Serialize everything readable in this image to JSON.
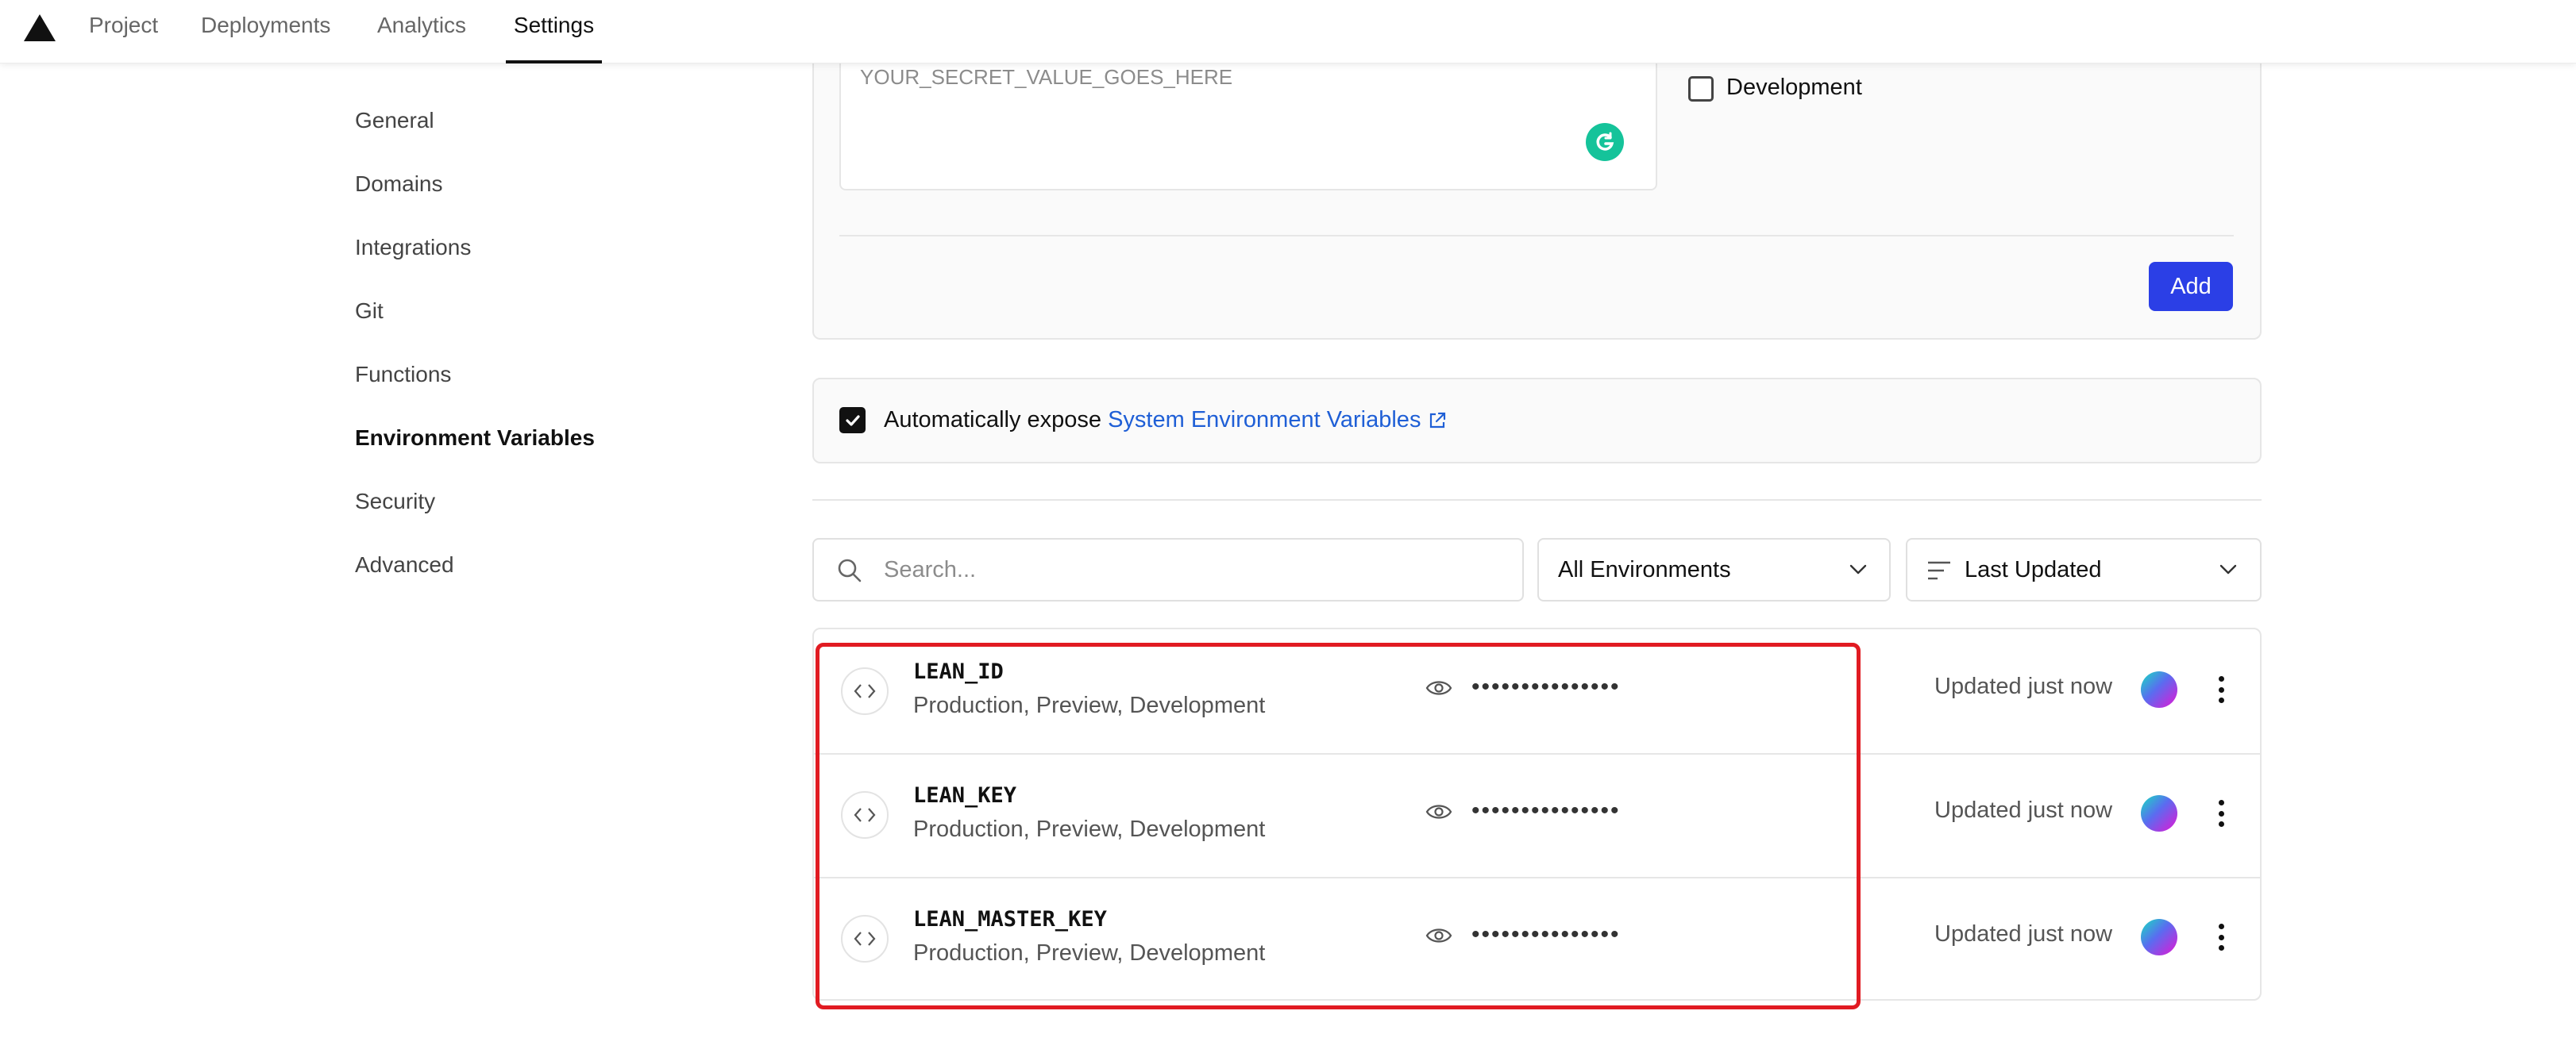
{
  "nav": {
    "tabs": [
      {
        "label": "Project"
      },
      {
        "label": "Deployments"
      },
      {
        "label": "Analytics"
      },
      {
        "label": "Settings",
        "active": true
      }
    ]
  },
  "sidebar": {
    "items": [
      {
        "label": "General"
      },
      {
        "label": "Domains"
      },
      {
        "label": "Integrations"
      },
      {
        "label": "Git"
      },
      {
        "label": "Functions"
      },
      {
        "label": "Environment Variables",
        "active": true
      },
      {
        "label": "Security"
      },
      {
        "label": "Advanced"
      }
    ]
  },
  "form": {
    "value_placeholder": "YOUR_SECRET_VALUE_GOES_HERE",
    "development_label": "Development",
    "development_checked": false,
    "add_label": "Add"
  },
  "expose": {
    "checked": true,
    "text": "Automatically expose",
    "link": "System Environment Variables"
  },
  "filters": {
    "search_placeholder": "Search...",
    "environment": "All Environments",
    "sort": "Last Updated"
  },
  "variables": [
    {
      "name": "LEAN_ID",
      "environments": "Production, Preview, Development",
      "value": "•••••••••••••••",
      "updated": "Updated just now"
    },
    {
      "name": "LEAN_KEY",
      "environments": "Production, Preview, Development",
      "value": "•••••••••••••••",
      "updated": "Updated just now"
    },
    {
      "name": "LEAN_MASTER_KEY",
      "environments": "Production, Preview, Development",
      "value": "•••••••••••••••",
      "updated": "Updated just now"
    }
  ],
  "colors": {
    "accent": "#2b3fe6",
    "link": "#1f5fd6",
    "highlight": "#e11b22",
    "grammarly": "#15c39a"
  },
  "icons": [
    "logo-triangle-icon",
    "grammarly-icon",
    "checkmark-icon",
    "external-link-icon",
    "search-icon",
    "chevron-down-icon",
    "sort-lines-icon",
    "code-icon",
    "eye-icon",
    "more-vertical-icon"
  ]
}
